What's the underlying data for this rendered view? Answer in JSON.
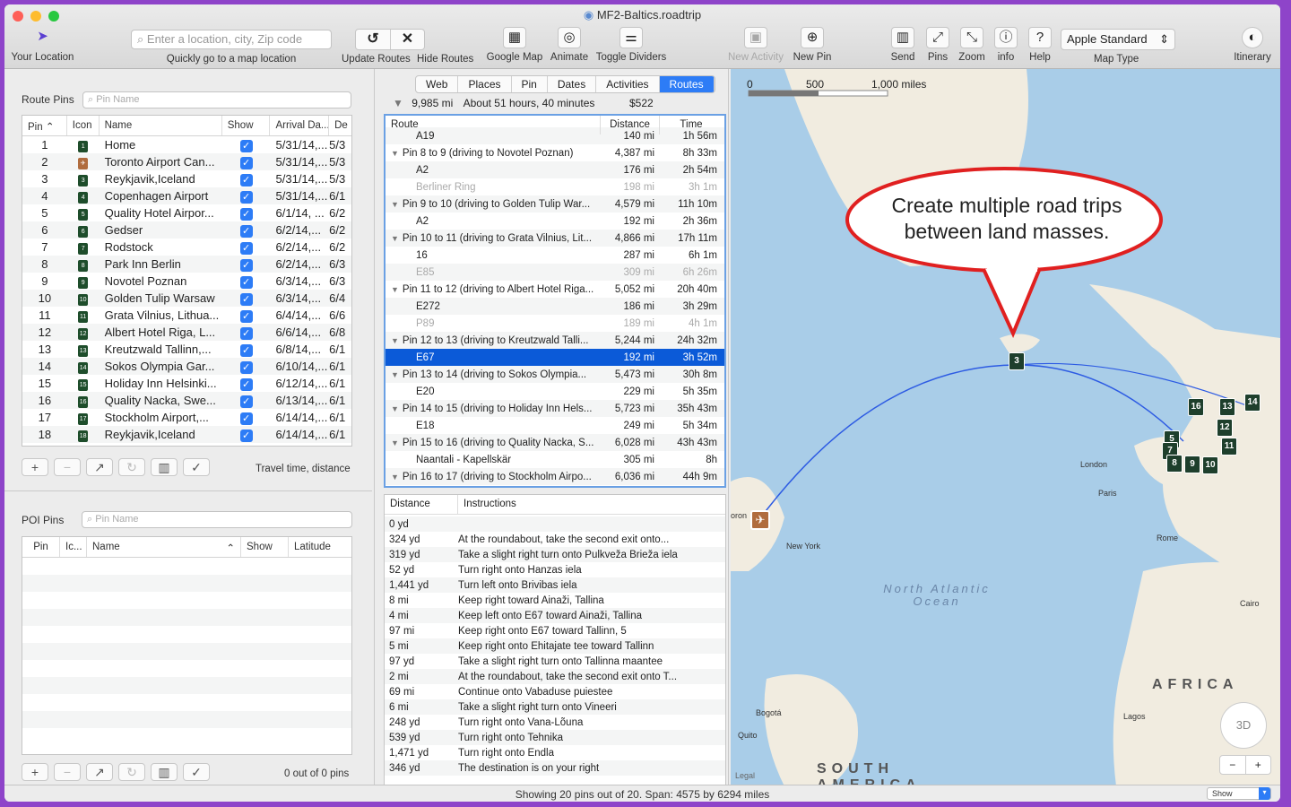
{
  "window": {
    "title": "MF2-Baltics.roadtrip",
    "status": "Showing 20 pins out of 20. Span: 4575 by 6294 miles",
    "status_select": "Show"
  },
  "toolbar": {
    "your_location": "Your Location",
    "search_placeholder": "Enter a location, city, Zip code",
    "search_label": "Quickly go to a map location",
    "update_routes": "Update Routes",
    "hide_routes": "Hide Routes",
    "google_map": "Google Map",
    "animate": "Animate",
    "toggle_dividers": "Toggle Dividers",
    "new_activity": "New Activity",
    "new_pin": "New Pin",
    "send": "Send",
    "pins": "Pins",
    "zoom": "Zoom",
    "info": "info",
    "help": "Help",
    "map_type_value": "Apple Standard",
    "map_type_label": "Map Type",
    "itinerary": "Itinerary"
  },
  "route_pins": {
    "title": "Route Pins",
    "search_placeholder": "Pin Name",
    "columns": [
      "Pin",
      "Icon",
      "Name",
      "Show",
      "Arrival Da...",
      "De"
    ],
    "rows": [
      {
        "pin": "1",
        "icon": "1",
        "name": "Home",
        "arrival": "5/31/14,...",
        "dep": "5/3"
      },
      {
        "pin": "2",
        "icon": "✈",
        "name": "Toronto Airport Can...",
        "arrival": "5/31/14,...",
        "dep": "5/3"
      },
      {
        "pin": "3",
        "icon": "3",
        "name": "Reykjavik,Iceland",
        "arrival": "5/31/14,...",
        "dep": "5/3"
      },
      {
        "pin": "4",
        "icon": "4",
        "name": "Copenhagen Airport",
        "arrival": "5/31/14,...",
        "dep": "6/1"
      },
      {
        "pin": "5",
        "icon": "5",
        "name": "Quality Hotel Airpor...",
        "arrival": "6/1/14, ...",
        "dep": "6/2"
      },
      {
        "pin": "6",
        "icon": "6",
        "name": "Gedser",
        "arrival": "6/2/14,...",
        "dep": "6/2"
      },
      {
        "pin": "7",
        "icon": "7",
        "name": "Rodstock",
        "arrival": "6/2/14,...",
        "dep": "6/2"
      },
      {
        "pin": "8",
        "icon": "8",
        "name": "Park Inn Berlin",
        "arrival": "6/2/14,...",
        "dep": "6/3"
      },
      {
        "pin": "9",
        "icon": "9",
        "name": "Novotel Poznan",
        "arrival": "6/3/14,...",
        "dep": "6/3"
      },
      {
        "pin": "10",
        "icon": "10",
        "name": "Golden Tulip Warsaw",
        "arrival": "6/3/14,...",
        "dep": "6/4"
      },
      {
        "pin": "11",
        "icon": "11",
        "name": "Grata Vilnius, Lithua...",
        "arrival": "6/4/14,...",
        "dep": "6/6"
      },
      {
        "pin": "12",
        "icon": "12",
        "name": "Albert Hotel Riga, L...",
        "arrival": "6/6/14,...",
        "dep": "6/8"
      },
      {
        "pin": "13",
        "icon": "13",
        "name": "Kreutzwald Tallinn,...",
        "arrival": "6/8/14,...",
        "dep": "6/1"
      },
      {
        "pin": "14",
        "icon": "14",
        "name": "Sokos Olympia Gar...",
        "arrival": "6/10/14,...",
        "dep": "6/1"
      },
      {
        "pin": "15",
        "icon": "15",
        "name": "Holiday Inn Helsinki...",
        "arrival": "6/12/14,...",
        "dep": "6/1"
      },
      {
        "pin": "16",
        "icon": "16",
        "name": "Quality Nacka, Swe...",
        "arrival": "6/13/14,...",
        "dep": "6/1"
      },
      {
        "pin": "17",
        "icon": "17",
        "name": "Stockholm Airport,...",
        "arrival": "6/14/14,...",
        "dep": "6/1"
      },
      {
        "pin": "18",
        "icon": "18",
        "name": "Reykjavik,Iceland",
        "arrival": "6/14/14,...",
        "dep": "6/1"
      }
    ],
    "footer_label": "Travel time, distance"
  },
  "poi_pins": {
    "title": "POI Pins",
    "search_placeholder": "Pin Name",
    "columns": [
      "Pin",
      "Ic...",
      "Name",
      "Show",
      "Latitude"
    ],
    "count": "0 out of 0 pins"
  },
  "tabs": [
    "Web",
    "Places",
    "Pin",
    "Dates",
    "Activities",
    "Routes"
  ],
  "summary": {
    "distance": "9,985 mi",
    "time": "About 51 hours, 40 minutes",
    "cost": "$522"
  },
  "routes_table": {
    "columns": [
      "Route",
      "Distance",
      "Time"
    ],
    "rows": [
      {
        "name": "A19",
        "dist": "140 mi",
        "time": "1h 56m",
        "type": "sub"
      },
      {
        "name": "Pin 8 to 9 (driving to Novotel Poznan)",
        "dist": "4,387 mi",
        "time": "8h 33m",
        "type": "head"
      },
      {
        "name": "A2",
        "dist": "176 mi",
        "time": "2h 54m",
        "type": "sub"
      },
      {
        "name": "Berliner Ring",
        "dist": "198 mi",
        "time": "3h 1m",
        "type": "grey"
      },
      {
        "name": "Pin 9 to 10 (driving to Golden Tulip War...",
        "dist": "4,579 mi",
        "time": "11h 10m",
        "type": "head"
      },
      {
        "name": "A2",
        "dist": "192 mi",
        "time": "2h 36m",
        "type": "sub"
      },
      {
        "name": "Pin 10 to 11 (driving to Grata Vilnius, Lit...",
        "dist": "4,866 mi",
        "time": "17h 11m",
        "type": "head"
      },
      {
        "name": "16",
        "dist": "287 mi",
        "time": "6h 1m",
        "type": "sub"
      },
      {
        "name": "E85",
        "dist": "309 mi",
        "time": "6h 26m",
        "type": "grey"
      },
      {
        "name": "Pin 11 to 12 (driving to Albert Hotel Riga...",
        "dist": "5,052 mi",
        "time": "20h 40m",
        "type": "head"
      },
      {
        "name": "E272",
        "dist": "186 mi",
        "time": "3h 29m",
        "type": "sub"
      },
      {
        "name": "P89",
        "dist": "189 mi",
        "time": "4h 1m",
        "type": "grey"
      },
      {
        "name": "Pin 12 to 13 (driving to Kreutzwald Talli...",
        "dist": "5,244 mi",
        "time": "24h 32m",
        "type": "head"
      },
      {
        "name": "E67",
        "dist": "192 mi",
        "time": "3h 52m",
        "type": "sel"
      },
      {
        "name": "Pin 13 to 14 (driving to Sokos Olympia...",
        "dist": "5,473 mi",
        "time": "30h 8m",
        "type": "head"
      },
      {
        "name": "E20",
        "dist": "229 mi",
        "time": "5h 35m",
        "type": "sub"
      },
      {
        "name": "Pin 14 to 15 (driving to Holiday Inn Hels...",
        "dist": "5,723 mi",
        "time": "35h 43m",
        "type": "head"
      },
      {
        "name": "E18",
        "dist": "249 mi",
        "time": "5h 34m",
        "type": "sub"
      },
      {
        "name": "Pin 15 to 16 (driving to Quality Nacka, S...",
        "dist": "6,028 mi",
        "time": "43h 43m",
        "type": "head"
      },
      {
        "name": "Naantali - Kapellskär",
        "dist": "305 mi",
        "time": "8h",
        "type": "sub"
      },
      {
        "name": "Pin 16 to 17 (driving to Stockholm Airpo...",
        "dist": "6,036 mi",
        "time": "44h 9m",
        "type": "head"
      }
    ]
  },
  "instructions": {
    "columns": [
      "Distance",
      "Instructions"
    ],
    "rows": [
      [
        "0 yd",
        ""
      ],
      [
        "324 yd",
        "At the roundabout, take the second exit onto..."
      ],
      [
        "319 yd",
        "Take a slight right turn onto Pulkveža Brieža iela"
      ],
      [
        "52 yd",
        "Turn right onto Hanzas iela"
      ],
      [
        "1,441 yd",
        "Turn left onto Brivibas iela"
      ],
      [
        "8 mi",
        "Keep right toward Ainaži, Tallina"
      ],
      [
        "4 mi",
        "Keep left onto E67 toward Ainaži, Tallina"
      ],
      [
        "97 mi",
        "Keep right onto E67 toward Tallinn, 5"
      ],
      [
        "5 mi",
        "Keep right onto Ehitajate tee toward Tallinn"
      ],
      [
        "97 yd",
        "Take a slight right turn onto Tallinna maantee"
      ],
      [
        "2 mi",
        "At the roundabout, take the second exit onto T..."
      ],
      [
        "69 mi",
        "Continue onto Vabaduse puiestee"
      ],
      [
        "6 mi",
        "Take a slight right turn onto Vineeri"
      ],
      [
        "248 yd",
        "Turn right onto Vana-Lõuna"
      ],
      [
        "539 yd",
        "Turn right onto Tehnika"
      ],
      [
        "1,471 yd",
        "Turn right onto Endla"
      ],
      [
        "346 yd",
        "The destination is on your right"
      ]
    ]
  },
  "map": {
    "scale": [
      "0",
      "500",
      "1,000 miles"
    ],
    "callout": "Create multiple road trips between land masses.",
    "labels": {
      "ocean": "North Atlantic Ocean",
      "africa": "AFRICA",
      "south_america": "SOUTH AMERICA",
      "london": "London",
      "paris": "Paris",
      "rome": "Rome",
      "cairo": "Cairo",
      "newyork": "New York",
      "bogota": "Bogotá",
      "quito": "Quito",
      "lagos": "Lagos",
      "toronto": "oron",
      "legal": "Legal"
    },
    "pins": [
      "3",
      "16",
      "13",
      "14",
      "12",
      "11",
      "5",
      "7",
      "8",
      "9",
      "10"
    ],
    "compass": "3D"
  }
}
